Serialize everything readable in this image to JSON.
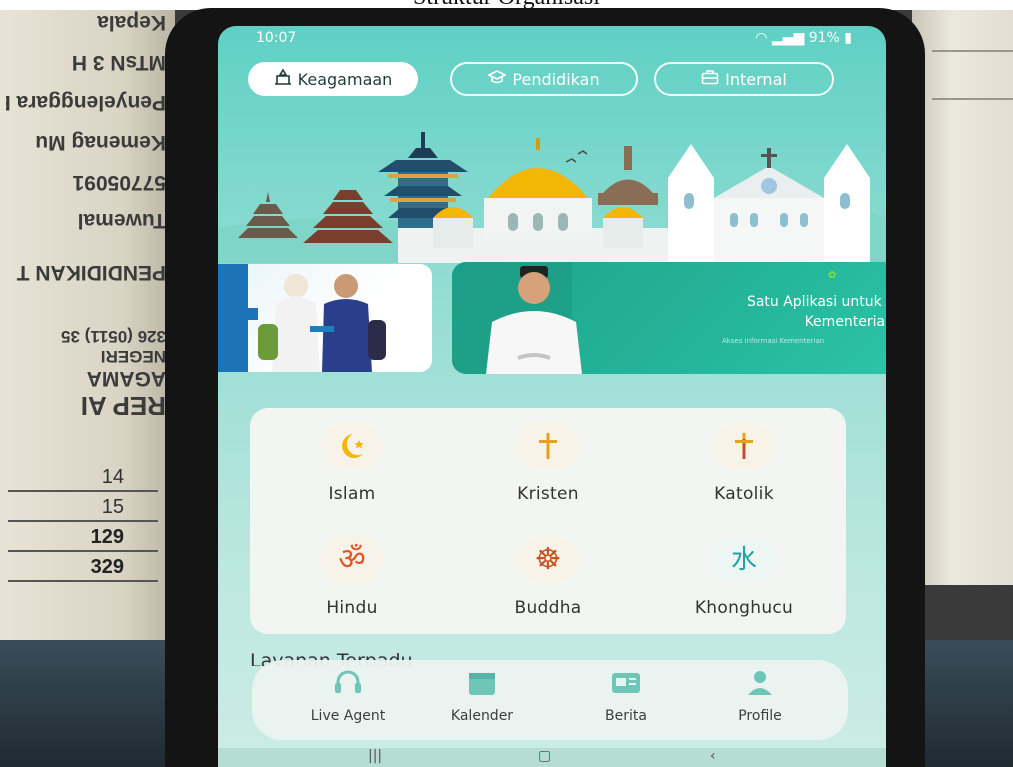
{
  "scene": {
    "caption": "Struktur Organisasi",
    "paper_left_mirrored_lines": [
      "Kepala",
      "MTsN 3 H",
      "Penyelenggara B",
      "Kemenag Mu",
      "57705091",
      "Tuwemal",
      "PENDIDIKAN T",
      "326 (0511) 35",
      "NEGERI",
      "AGAMA",
      "REP AI"
    ],
    "paper_left_numbers": [
      "14",
      "15",
      "129",
      "329"
    ]
  },
  "status_bar": {
    "time": "10:07",
    "battery": "91%"
  },
  "categories": [
    {
      "label": "Keagamaan",
      "icon": "mosque-icon",
      "active": true
    },
    {
      "label": "Pendidikan",
      "icon": "graduation-cap-icon",
      "active": false
    },
    {
      "label": "Internal",
      "icon": "briefcase-icon",
      "active": false
    }
  ],
  "banner": {
    "tagline_line1": "Satu Aplikasi untuk L",
    "tagline_line2": "Kementerian",
    "fine_print": "Akses informasi Kementerian"
  },
  "religions": [
    {
      "label": "Islam",
      "icon": "crescent-star-icon",
      "glyph": "☪",
      "color": "#f2b705"
    },
    {
      "label": "Kristen",
      "icon": "cross-icon",
      "glyph": "✝",
      "color": "#e6a21d"
    },
    {
      "label": "Katolik",
      "icon": "catholic-cross-icon",
      "glyph": "✝",
      "color": "#c44b3a"
    },
    {
      "label": "Hindu",
      "icon": "om-icon",
      "glyph": "ॐ",
      "color": "#e0572b"
    },
    {
      "label": "Buddha",
      "icon": "dharma-wheel-icon",
      "glyph": "☸",
      "color": "#c6531e"
    },
    {
      "label": "Khonghucu",
      "icon": "confucian-symbol-icon",
      "glyph": "水",
      "color": "#1aa6a6"
    }
  ],
  "section": {
    "title": "Layanan Terpadu"
  },
  "bottom_nav": [
    {
      "label": "Live Agent",
      "icon": "headset-icon"
    },
    {
      "label": "Kalender",
      "icon": "calendar-icon"
    },
    {
      "label": "Berita",
      "icon": "news-icon"
    },
    {
      "label": "Profile",
      "icon": "person-icon"
    }
  ],
  "colors": {
    "nav_icon": "#6fc6b8",
    "teal_accent": "#1fa58b"
  }
}
